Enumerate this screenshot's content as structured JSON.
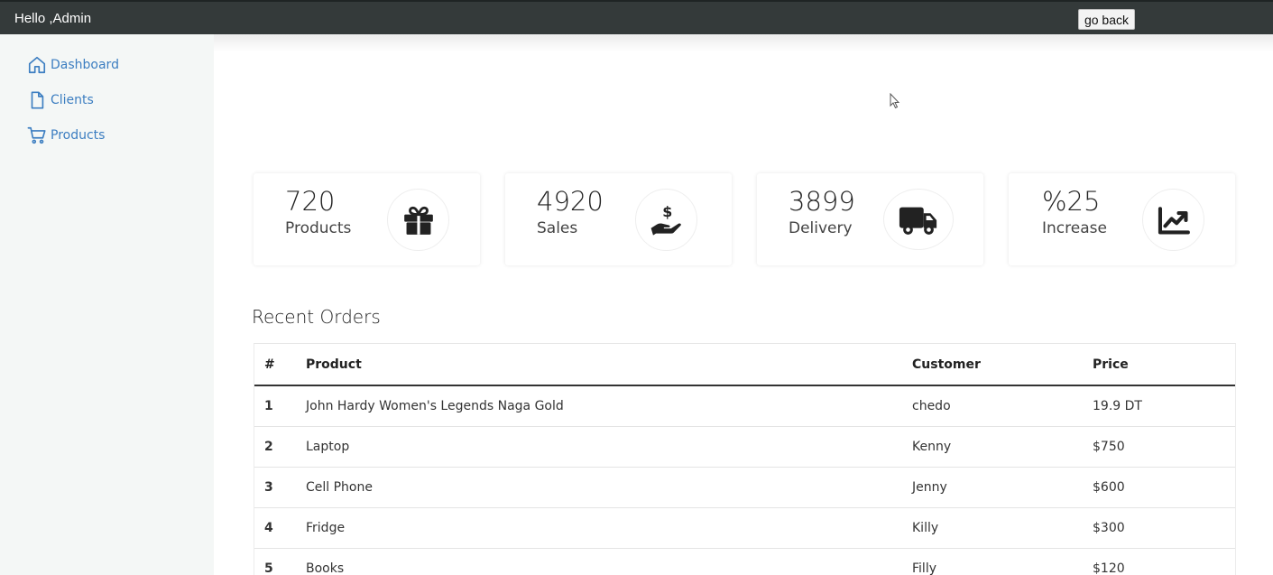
{
  "header": {
    "greeting": "Hello ,Admin",
    "go_back_label": "go back",
    "bg_color": "#343a3a"
  },
  "sidebar": {
    "items": [
      {
        "label": "Dashboard",
        "icon": "home-icon"
      },
      {
        "label": "Clients",
        "icon": "file-icon"
      },
      {
        "label": "Products",
        "icon": "cart-icon"
      }
    ],
    "link_color": "#3c7ec1"
  },
  "stats": [
    {
      "value": "720",
      "label": "Products",
      "icon": "gift-icon"
    },
    {
      "value": "4920",
      "label": "Sales",
      "icon": "hand-dollar-icon"
    },
    {
      "value": "3899",
      "label": "Delivery",
      "icon": "truck-icon"
    },
    {
      "value": "%25",
      "label": "Increase",
      "icon": "chart-line-icon"
    }
  ],
  "orders": {
    "title": "Recent Orders",
    "columns": [
      "#",
      "Product",
      "Customer",
      "Price"
    ],
    "rows": [
      {
        "num": "1",
        "product": "John Hardy Women's Legends Naga Gold",
        "customer": "chedo",
        "price": "19.9 DT"
      },
      {
        "num": "2",
        "product": "Laptop",
        "customer": "Kenny",
        "price": "$750"
      },
      {
        "num": "3",
        "product": "Cell Phone",
        "customer": "Jenny",
        "price": "$600"
      },
      {
        "num": "4",
        "product": "Fridge",
        "customer": "Killy",
        "price": "$300"
      },
      {
        "num": "5",
        "product": "Books",
        "customer": "Filly",
        "price": "$120"
      }
    ]
  }
}
